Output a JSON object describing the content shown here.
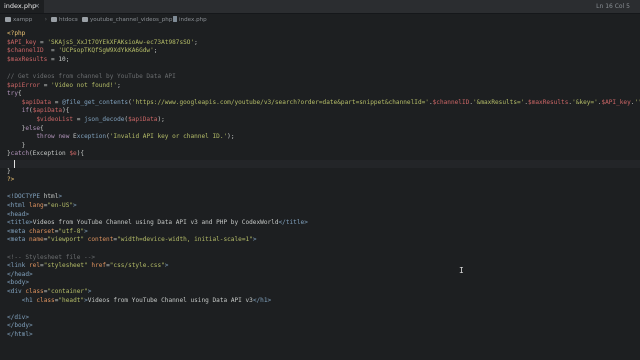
{
  "tabs": [
    {
      "label": "index.php",
      "active": true
    }
  ],
  "status": {
    "cursor": "Ln 16 Col 5"
  },
  "breadcrumbs": [
    {
      "label": "xampp",
      "icon": "folder-icon"
    },
    {
      "label": "htdocs",
      "icon": "folder-icon"
    },
    {
      "label": "youtube_channel_videos_php",
      "icon": "folder-icon"
    },
    {
      "label": "index.php",
      "icon": "file-icon"
    }
  ],
  "code": [
    "<?php",
    "$API_key = 'SKAjsS_XxJt7OYEkXFAKsioAw-ec73At987sSO';",
    "$channelID  = 'UCPsopTKQfSgW9XdYkKA6Gdw';",
    "$maxResults = 10;",
    "",
    "// Get videos from channel by YouTube Data API",
    "$apiError = 'Video not found!';",
    "try{",
    "    $apiData = @file_get_contents('https://www.googleapis.com/youtube/v3/search?order=date&part=snippet&channelId='.$channelID.'&maxResults='.$maxResults.'&key='.$API_key.'');",
    "    if($apiData){",
    "        $videoList = json_decode($apiData);",
    "    }else{",
    "        throw new Exception('Invalid API key or channel ID.');",
    "    }",
    "}catch(Exception $e){",
    "",
    "}",
    "?>",
    "",
    "<!DOCTYPE html>",
    "<html lang=\"en-US\">",
    "<head>",
    "<title>Videos from YouTube Channel using Data API v3 and PHP by CodexWorld</title>",
    "<meta charset=\"utf-8\">",
    "<meta name=\"viewport\" content=\"width=device-width, initial-scale=1\">",
    "",
    "<!-- Stylesheet file -->",
    "<link rel=\"stylesheet\" href=\"css/style.css\">",
    "</head>",
    "<body>",
    "<div class=\"container\">",
    "    <h1 class=\"headt\">Videos from YouTube Channel using Data API v3</h1>",
    "",
    "</div>",
    "</body>",
    "</html>"
  ]
}
